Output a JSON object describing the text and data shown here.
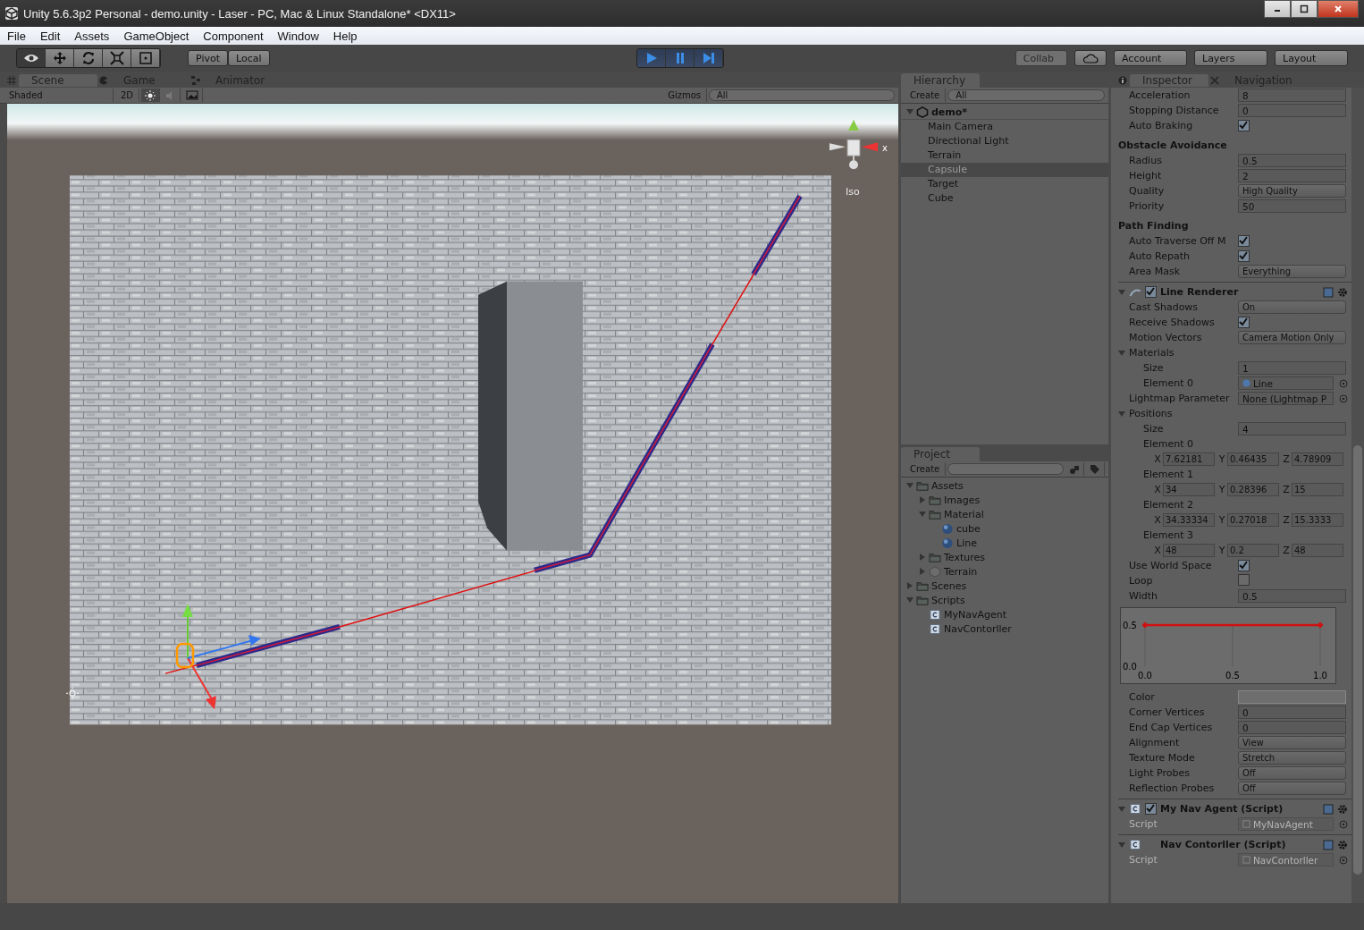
{
  "window": {
    "title": "Unity 5.6.3p2 Personal - demo.unity - Laser - PC, Mac & Linux Standalone* <DX11>"
  },
  "menu": [
    "File",
    "Edit",
    "Assets",
    "GameObject",
    "Component",
    "Window",
    "Help"
  ],
  "toolbar": {
    "tools": [
      {
        "kind": "view",
        "selected": true
      },
      {
        "kind": "move",
        "selected": false
      },
      {
        "kind": "rotate",
        "selected": false
      },
      {
        "kind": "scale",
        "selected": false
      },
      {
        "kind": "rect",
        "selected": false
      }
    ],
    "pivot": "Pivot",
    "space": "Local",
    "playing": true,
    "play_controls": [
      {
        "kind": "play"
      },
      {
        "kind": "pause"
      },
      {
        "kind": "step"
      }
    ],
    "collab": {
      "label": "Collab",
      "disabled": true
    },
    "account": "Account",
    "layers": "Layers",
    "layout": "Layout"
  },
  "scene": {
    "tabs": [
      {
        "label": "Scene",
        "kind": "scene",
        "selected": true
      },
      {
        "label": "Game",
        "kind": "game",
        "selected": false
      },
      {
        "label": "Animator",
        "kind": "animator",
        "selected": false
      }
    ],
    "shading": "Shaded",
    "mode_2d": "2D",
    "lighting_on": true,
    "audio_on": false,
    "gizmos": "Gizmos",
    "search": {
      "placeholder": "All"
    },
    "projection": "Iso",
    "axis_label": "x"
  },
  "hierarchy": {
    "title": "Hierarchy",
    "create": "Create",
    "search": {
      "placeholder": "All"
    },
    "scene": "demo*",
    "items": [
      {
        "label": "Main Camera",
        "selected": false
      },
      {
        "label": "Directional Light",
        "selected": false
      },
      {
        "label": "Terrain",
        "selected": false
      },
      {
        "label": "Capsule",
        "selected": true
      },
      {
        "label": "Target",
        "selected": false
      },
      {
        "label": "Cube",
        "selected": false
      }
    ]
  },
  "project": {
    "title": "Project",
    "create": "Create",
    "tree": [
      {
        "label": "Assets",
        "kind": "folder",
        "expanded": true,
        "children": [
          {
            "label": "Images",
            "kind": "folder",
            "expanded": false
          },
          {
            "label": "Material",
            "kind": "folder",
            "expanded": true,
            "children": [
              {
                "label": "cube",
                "kind": "material"
              },
              {
                "label": "Line",
                "kind": "material"
              }
            ]
          },
          {
            "label": "Textures",
            "kind": "folder",
            "expanded": false
          },
          {
            "label": "Terrain",
            "kind": "terrain",
            "expanded": false
          }
        ]
      },
      {
        "label": "Scenes",
        "kind": "folder",
        "expanded": false
      },
      {
        "label": "Scripts",
        "kind": "folder",
        "expanded": true,
        "children": [
          {
            "label": "MyNavAgent",
            "kind": "script"
          },
          {
            "label": "NavContorller",
            "kind": "script"
          }
        ]
      }
    ]
  },
  "inspector": {
    "tabs": [
      {
        "label": "Inspector",
        "kind": "info",
        "selected": true
      },
      {
        "label": "Navigation",
        "kind": "nav",
        "selected": false
      }
    ],
    "rows": [
      {
        "kind": "field",
        "label": "Acceleration",
        "value": "8"
      },
      {
        "kind": "field",
        "label": "Stopping Distance",
        "value": "0"
      },
      {
        "kind": "check",
        "label": "Auto Braking",
        "checked": true
      },
      {
        "kind": "header",
        "label": "Obstacle Avoidance"
      },
      {
        "kind": "field",
        "label": "Radius",
        "value": "0.5"
      },
      {
        "kind": "field",
        "label": "Height",
        "value": "2"
      },
      {
        "kind": "dropdown",
        "label": "Quality",
        "value": "High Quality"
      },
      {
        "kind": "field",
        "label": "Priority",
        "value": "50"
      },
      {
        "kind": "header",
        "label": "Path Finding"
      },
      {
        "kind": "check",
        "label": "Auto Traverse Off M",
        "checked": true
      },
      {
        "kind": "check",
        "label": "Auto Repath",
        "checked": true
      },
      {
        "kind": "dropdown",
        "label": "Area Mask",
        "value": "Everything"
      },
      {
        "kind": "component",
        "label": "Line Renderer",
        "enabled": true,
        "expanded": true,
        "children": [
          {
            "kind": "dropdown",
            "label": "Cast Shadows",
            "value": "On"
          },
          {
            "kind": "check",
            "label": "Receive Shadows",
            "checked": true
          },
          {
            "kind": "dropdown",
            "label": "Motion Vectors",
            "value": "Camera Motion Only"
          },
          {
            "kind": "foldout",
            "label": "Materials",
            "expanded": true,
            "children": [
              {
                "kind": "field",
                "label": "Size",
                "value": "1"
              },
              {
                "kind": "object",
                "label": "Element 0",
                "value": "Line",
                "disabled": false
              }
            ]
          },
          {
            "kind": "object",
            "label": "Lightmap Parameter",
            "value": "None (Lightmap P",
            "disabled": false
          },
          {
            "kind": "foldout",
            "label": "Positions",
            "expanded": true,
            "children": [
              {
                "kind": "field",
                "label": "Size",
                "value": "4"
              },
              {
                "kind": "vector",
                "label": "Element 0",
                "values": [
                  {
                    "axis": "X",
                    "value": "7.62181"
                  },
                  {
                    "axis": "Y",
                    "value": "0.46435"
                  },
                  {
                    "axis": "Z",
                    "value": "4.78909"
                  }
                ]
              },
              {
                "kind": "vector",
                "label": "Element 1",
                "values": [
                  {
                    "axis": "X",
                    "value": "34"
                  },
                  {
                    "axis": "Y",
                    "value": "0.28396"
                  },
                  {
                    "axis": "Z",
                    "value": "15"
                  }
                ]
              },
              {
                "kind": "vector",
                "label": "Element 2",
                "values": [
                  {
                    "axis": "X",
                    "value": "34.33334"
                  },
                  {
                    "axis": "Y",
                    "value": "0.27018"
                  },
                  {
                    "axis": "Z",
                    "value": "15.3333"
                  }
                ]
              },
              {
                "kind": "vector",
                "label": "Element 3",
                "values": [
                  {
                    "axis": "X",
                    "value": "48"
                  },
                  {
                    "axis": "Y",
                    "value": "0.2"
                  },
                  {
                    "axis": "Z",
                    "value": "48"
                  }
                ]
              }
            ]
          },
          {
            "kind": "check",
            "label": "Use World Space",
            "checked": true
          },
          {
            "kind": "check",
            "label": "Loop",
            "checked": false
          },
          {
            "kind": "field",
            "label": "Width",
            "value": "0.5"
          },
          {
            "kind": "curve",
            "chart_data": {
              "type": "line",
              "x": [
                0,
                1
              ],
              "series": [
                {
                  "color": "#d01010",
                  "marker": "diamond",
                  "values": [
                    0.5,
                    0.5
                  ]
                }
              ],
              "xlim": [
                0,
                1
              ],
              "ylim": [
                0,
                0.5
              ],
              "xticks": [
                {
                  "value": 0,
                  "label": "0.0"
                },
                {
                  "value": 0.5,
                  "label": "0.5"
                },
                {
                  "value": 1,
                  "label": "1.0"
                }
              ],
              "yticks": [
                {
                  "value": 0,
                  "label": "0.0"
                },
                {
                  "value": 0.5,
                  "label": "0.5"
                }
              ]
            }
          },
          {
            "kind": "color",
            "label": "Color"
          },
          {
            "kind": "field",
            "label": "Corner Vertices",
            "value": "0"
          },
          {
            "kind": "field",
            "label": "End Cap Vertices",
            "value": "0"
          },
          {
            "kind": "dropdown",
            "label": "Alignment",
            "value": "View"
          },
          {
            "kind": "dropdown",
            "label": "Texture Mode",
            "value": "Stretch"
          },
          {
            "kind": "dropdown",
            "label": "Light Probes",
            "value": "Off"
          },
          {
            "kind": "dropdown",
            "label": "Reflection Probes",
            "value": "Off"
          }
        ]
      },
      {
        "kind": "component",
        "label": "My Nav Agent (Script)",
        "enabled": true,
        "expanded": true,
        "children": [
          {
            "kind": "object",
            "label": "Script",
            "value": "MyNavAgent",
            "disabled": true
          }
        ]
      },
      {
        "kind": "component",
        "label": "Nav Contorller (Script)",
        "expanded": true,
        "children": [
          {
            "kind": "object",
            "label": "Script",
            "value": "NavContorller",
            "disabled": true
          }
        ]
      }
    ]
  }
}
